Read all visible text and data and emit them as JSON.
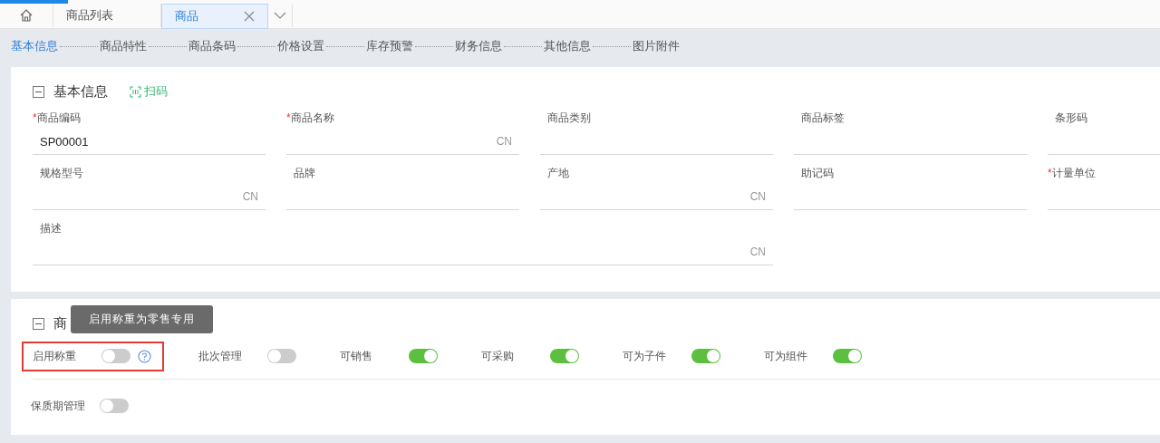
{
  "tabs": [
    {
      "label": "商品列表",
      "selected": false,
      "closable": false
    },
    {
      "label": "商品",
      "selected": true,
      "closable": true
    }
  ],
  "steps": [
    {
      "label": "基本信息",
      "selected": true
    },
    {
      "label": "商品特性",
      "selected": false
    },
    {
      "label": "商品条码",
      "selected": false
    },
    {
      "label": "价格设置",
      "selected": false
    },
    {
      "label": "库存预警",
      "selected": false
    },
    {
      "label": "财务信息",
      "selected": false
    },
    {
      "label": "其他信息",
      "selected": false
    },
    {
      "label": "图片附件",
      "selected": false
    }
  ],
  "basic": {
    "title": "基本信息",
    "expanded": true,
    "scan_label": "扫码",
    "fields": [
      {
        "label": "商品编码",
        "required_mark": "*",
        "value": "SP00001",
        "kind": "normal"
      },
      {
        "label": "商品名称",
        "required_mark": "*",
        "suffix": "CN",
        "kind": "normal"
      },
      {
        "label": "商品类别",
        "kind": "normal"
      },
      {
        "label": "商品标签",
        "kind": "normal"
      },
      {
        "label": "条形码",
        "kind": "normal"
      },
      {
        "label": "规格型号",
        "suffix": "CN",
        "kind": "normal"
      },
      {
        "label": "品牌",
        "kind": "normal"
      },
      {
        "label": "产地",
        "suffix": "CN",
        "kind": "normal"
      },
      {
        "label": "助记码",
        "kind": "normal"
      },
      {
        "label": "计量单位",
        "required_mark": "*",
        "kind": "normal"
      },
      {
        "label": "描述",
        "suffix": "CN",
        "kind": "wide"
      }
    ]
  },
  "features": {
    "title": "商",
    "expanded": true,
    "tooltip": "启用称重为零售专用",
    "rows": [
      [
        {
          "label": "启用称重",
          "on": false,
          "help": true,
          "highlighted": true
        },
        {
          "label": "批次管理",
          "on": false,
          "help": false,
          "highlighted": false
        },
        {
          "label": "可销售",
          "on": true,
          "help": false,
          "highlighted": false
        },
        {
          "label": "可采购",
          "on": true,
          "help": false,
          "highlighted": false
        },
        {
          "label": "可为子件",
          "on": true,
          "help": false,
          "highlighted": false
        },
        {
          "label": "可为组件",
          "on": true,
          "help": false,
          "highlighted": false
        }
      ],
      [
        {
          "label": "保质期管理",
          "on": false,
          "help": false,
          "highlighted": false
        }
      ]
    ]
  }
}
